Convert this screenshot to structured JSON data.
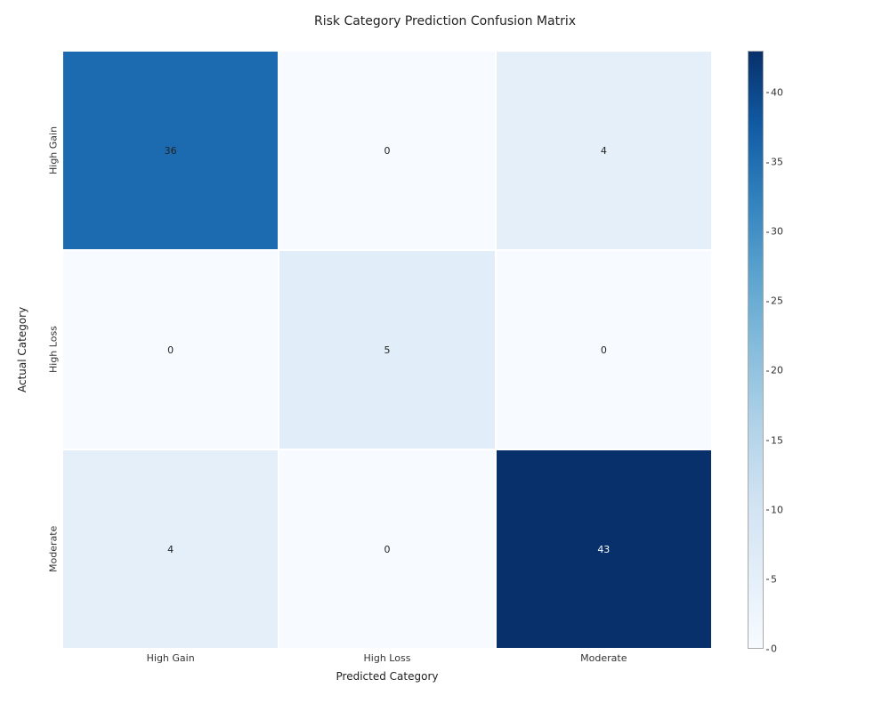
{
  "chart_data": {
    "type": "heatmap",
    "title": "Risk Category Prediction Confusion Matrix",
    "xlabel": "Predicted Category",
    "ylabel": "Actual Category",
    "x_categories": [
      "High Gain",
      "High Loss",
      "Moderate"
    ],
    "y_categories": [
      "High Gain",
      "High Loss",
      "Moderate"
    ],
    "values": [
      [
        36,
        0,
        4
      ],
      [
        0,
        5,
        0
      ],
      [
        4,
        0,
        43
      ]
    ],
    "vmin": 0,
    "vmax": 43,
    "colorbar_ticks": [
      0,
      5,
      10,
      15,
      20,
      25,
      30,
      35,
      40
    ],
    "cell_colors": [
      [
        "#1c6bb0",
        "#f7fbff",
        "#e4eff9"
      ],
      [
        "#f7fbff",
        "#e1edf8",
        "#f7fbff"
      ],
      [
        "#e4eff9",
        "#f7fbff",
        "#08306b"
      ]
    ],
    "cell_text_colors": [
      [
        "#222222",
        "#222222",
        "#222222"
      ],
      [
        "#222222",
        "#222222",
        "#222222"
      ],
      [
        "#222222",
        "#222222",
        "#ffffff"
      ]
    ]
  }
}
